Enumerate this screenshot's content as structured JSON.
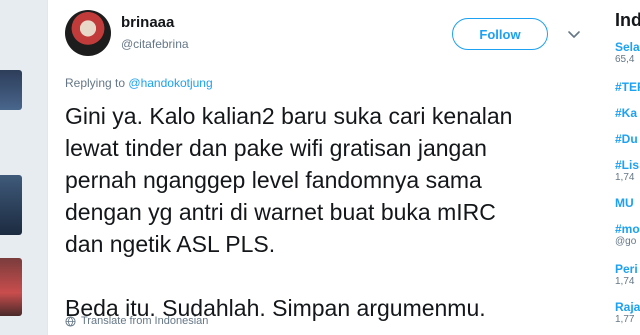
{
  "tweet": {
    "display_name": "brinaaa",
    "handle": "@citafebrina",
    "follow_label": "Follow",
    "replying_prefix": "Replying to",
    "replying_to": "@handokotjung",
    "text_lines": [
      "Gini ya. Kalo kalian2 baru suka cari kenalan",
      "lewat tinder dan pake wifi gratisan jangan",
      "pernah nganggep level fandomnya sama",
      "dengan yg antri di warnet buat buka mIRC",
      "dan ngetik ASL PLS."
    ],
    "text_last": "Beda itu. Sudahlah. Simpan argumenmu.",
    "translate_label": "Translate from Indonesian"
  },
  "trends": {
    "title": "Ind",
    "items": [
      {
        "tag": "Sela",
        "sub": "65,4"
      },
      {
        "tag": "#TER",
        "sub": ""
      },
      {
        "tag": "#Ka",
        "sub": ""
      },
      {
        "tag": "#Du",
        "sub": ""
      },
      {
        "tag": "#Lis",
        "sub": "1,74"
      },
      {
        "tag": "MU",
        "sub": ""
      },
      {
        "tag": "#mo",
        "sub": "@go"
      },
      {
        "tag": "Peri",
        "sub": "1,74"
      },
      {
        "tag": "Raja",
        "sub": "1,77"
      }
    ]
  },
  "colors": {
    "accent": "#1da1f2",
    "text": "#14171a",
    "muted": "#657786",
    "background": "#e6ecf0"
  },
  "icons": [
    "chevron-down-icon",
    "globe-icon"
  ]
}
